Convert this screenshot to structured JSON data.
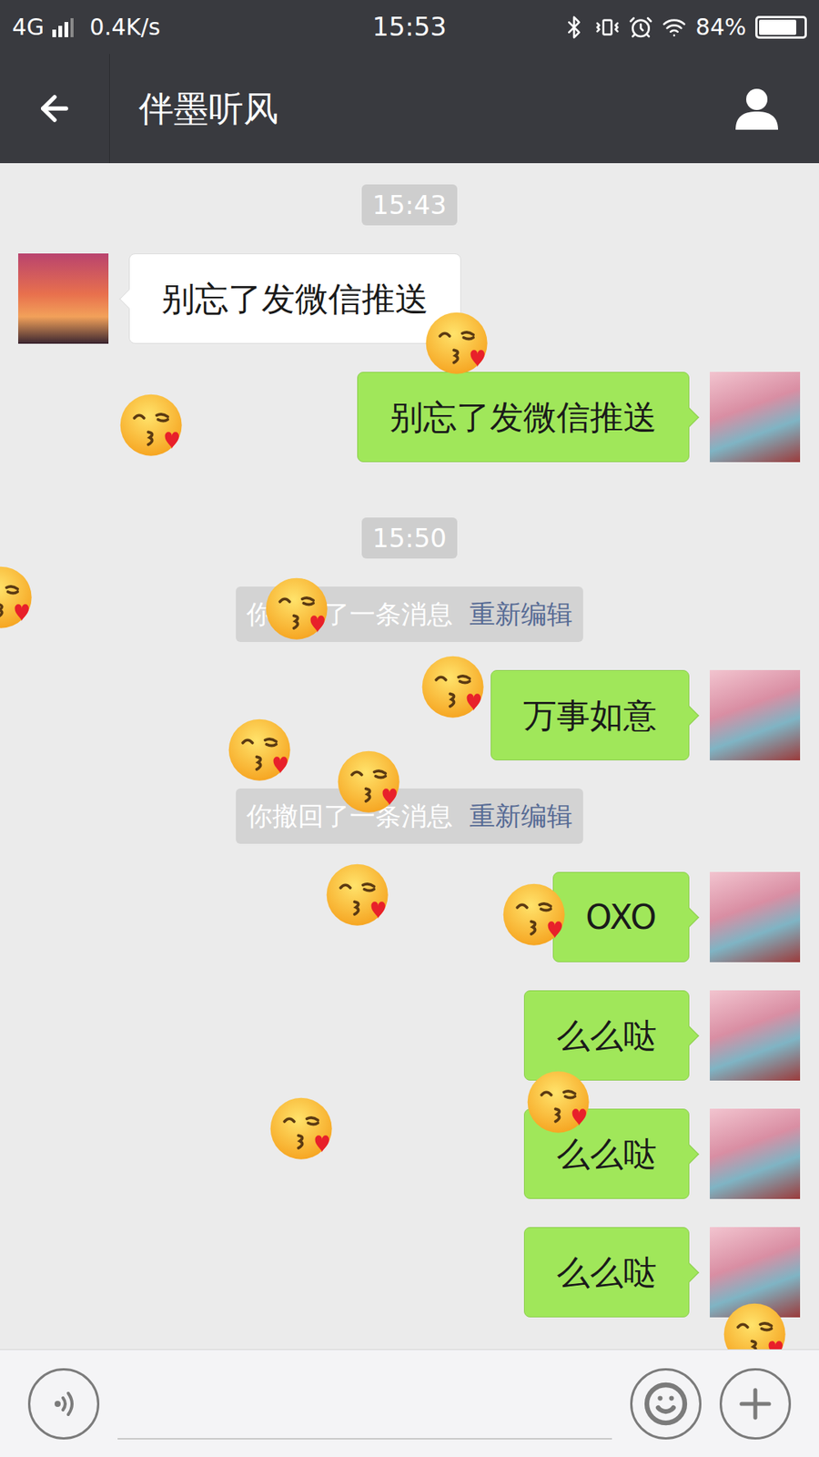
{
  "status_bar": {
    "network": "4G",
    "speed": "0.4K/s",
    "time": "15:53",
    "battery": "84%",
    "battery_level": 0.84
  },
  "header": {
    "title": "伴墨听风"
  },
  "messages": [
    {
      "kind": "time",
      "text": "15:43"
    },
    {
      "kind": "incoming",
      "text": "别忘了发微信推送"
    },
    {
      "kind": "outgoing",
      "text": "别忘了发微信推送"
    },
    {
      "kind": "time",
      "text": "15:50"
    },
    {
      "kind": "system",
      "text": "你撤回了一条消息",
      "action": "重新编辑"
    },
    {
      "kind": "outgoing",
      "text": "万事如意"
    },
    {
      "kind": "system",
      "text": "你撤回了一条消息",
      "action": "重新编辑"
    },
    {
      "kind": "outgoing",
      "text": "OXO"
    },
    {
      "kind": "outgoing",
      "text": "么么哒"
    },
    {
      "kind": "outgoing",
      "text": "么么哒"
    },
    {
      "kind": "outgoing",
      "text": "么么哒"
    }
  ]
}
